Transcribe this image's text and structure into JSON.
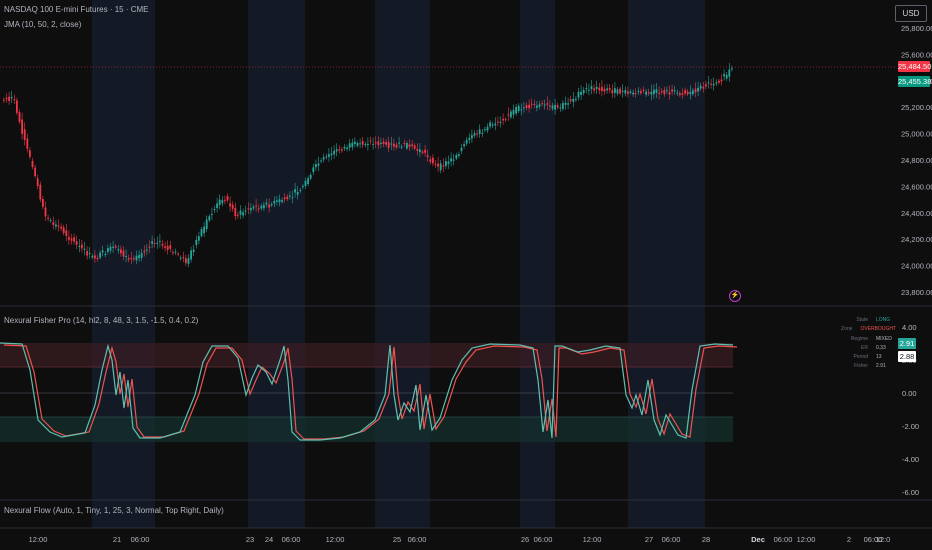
{
  "legends": {
    "symbol": "NASDAQ 100 E-mini Futures · 15 · CME",
    "jma": "JMA (10, 50, 2, close)",
    "fisher": "Nexural Fisher Pro (14, hl2, 8, 48, 3, 1.5, -1.5, 0.4, 0.2)",
    "flow": "Nexural Flow (Auto, 1, Tiny, 1, 25, 3, Normal, Top Right, Daily)"
  },
  "currency": "USD",
  "price_axis": {
    "ticks": [
      "25,800.00",
      "25,600.00",
      "25,400.00",
      "25,200.00",
      "25,000.00",
      "24,800.00",
      "24,600.00",
      "24,400.00",
      "24,200.00",
      "24,000.00",
      "23,800.00"
    ],
    "last_price": "25,484.50",
    "jma_price": "25,455.38"
  },
  "fisher_axis": {
    "ticks": [
      "4.00",
      "2.00",
      "0.00",
      "-2.00",
      "-4.00",
      "-6.00"
    ],
    "tag_fisher": "2.91",
    "tag_trigger": "2.88"
  },
  "time_axis": [
    "12:00",
    "21",
    "06:00",
    "23",
    "24",
    "06:00",
    "12:00",
    "25",
    "06:00",
    "26",
    "06:00",
    "12:00",
    "27",
    "06:00",
    "28",
    "Dec",
    "06:00",
    "12:00",
    "2",
    "06:00",
    "12:0"
  ],
  "stats": [
    {
      "key": "State",
      "value": "LONG",
      "color": "#26a69a"
    },
    {
      "key": "Zone",
      "value": "OVERBOUGHT",
      "color": "#ef5350"
    },
    {
      "key": "Regime",
      "value": "MIXED",
      "color": "#b2b5be"
    },
    {
      "key": "ER",
      "value": "0.33",
      "color": "#b2b5be"
    },
    {
      "key": "Period",
      "value": "13",
      "color": "#b2b5be"
    },
    {
      "key": "Fisher",
      "value": "2.91",
      "color": "#b2b5be"
    }
  ],
  "colors": {
    "up": "#26a69a",
    "down": "#f23645",
    "fisher": "#5fbfb0",
    "trigger": "#ef5350"
  }
}
